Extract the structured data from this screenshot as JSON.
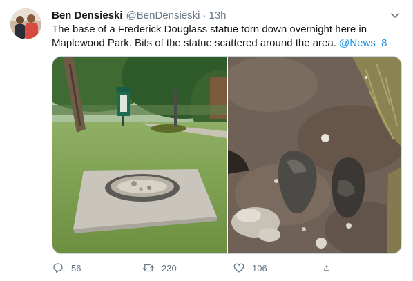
{
  "tweet": {
    "author_name": "Ben Densieski",
    "author_handle": "@BenDensieski",
    "separator": "·",
    "time": "13h",
    "text_line1": "The base of a Frederick Douglass statue torn down overnight here in",
    "text_line2_prefix": "Maplewood Park. Bits of the statue scattered around the area. ",
    "mention": "@News_8",
    "colors": {
      "link": "#1b95e0",
      "secondary_text": "#657786"
    }
  },
  "actions": {
    "reply_icon": "reply-icon",
    "reply_count": "56",
    "retweet_icon": "retweet-icon",
    "retweet_count": "230",
    "like_icon": "heart-icon",
    "like_count": "106",
    "share_icon": "share-icon"
  }
}
